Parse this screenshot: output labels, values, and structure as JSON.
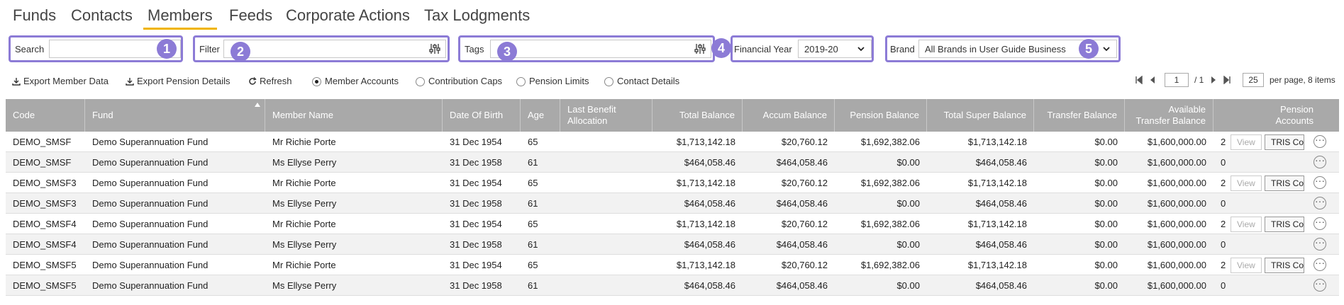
{
  "nav": {
    "tabs": [
      "Funds",
      "Contacts",
      "Members",
      "Feeds",
      "Corporate Actions",
      "Tax Lodgments"
    ],
    "active": "Members"
  },
  "filters": {
    "search": {
      "label": "Search",
      "value": "",
      "badge": "1"
    },
    "filter": {
      "label": "Filter",
      "value": "",
      "badge": "2"
    },
    "tags": {
      "label": "Tags",
      "value": "",
      "badge": "3"
    },
    "financial_year": {
      "label": "Financial Year",
      "value": "2019-20",
      "badge": "4"
    },
    "brand": {
      "label": "Brand",
      "value": "All Brands in User Guide Business",
      "badge": "5"
    }
  },
  "toolbar": {
    "export_member": "Export Member Data",
    "export_pension": "Export Pension Details",
    "refresh": "Refresh",
    "views": [
      {
        "label": "Member Accounts",
        "selected": true
      },
      {
        "label": "Contribution Caps",
        "selected": false
      },
      {
        "label": "Pension Limits",
        "selected": false
      },
      {
        "label": "Contact Details",
        "selected": false
      }
    ]
  },
  "pager": {
    "page": "1",
    "of": "/ 1",
    "per_page": "25",
    "summary": "per page, 8 items"
  },
  "table": {
    "headers": {
      "code": "Code",
      "fund": "Fund",
      "member": "Member Name",
      "dob": "Date Of Birth",
      "age": "Age",
      "lba": "Last Benefit Allocation",
      "total": "Total Balance",
      "accum": "Accum Balance",
      "pension": "Pension Balance",
      "super": "Total Super Balance",
      "transfer": "Transfer Balance",
      "avail": "Available Transfer Balance",
      "accounts": "Pension Accounts"
    },
    "sorted_column": "fund",
    "rows": [
      {
        "code": "DEMO_SMSF",
        "fund": "Demo Superannuation Fund",
        "member": "Mr Richie Porte",
        "dob": "31 Dec 1954",
        "age": "65",
        "lba": "",
        "total": "$1,713,142.18",
        "accum": "$20,760.12",
        "pension": "$1,692,382.06",
        "super": "$1,713,142.18",
        "transfer": "$0.00",
        "avail": "$1,600,000.00",
        "accounts": "2",
        "view": "View",
        "tris": "TRIS Co"
      },
      {
        "code": "DEMO_SMSF",
        "fund": "Demo Superannuation Fund",
        "member": "Ms Ellyse Perry",
        "dob": "31 Dec 1958",
        "age": "61",
        "lba": "",
        "total": "$464,058.46",
        "accum": "$464,058.46",
        "pension": "$0.00",
        "super": "$464,058.46",
        "transfer": "$0.00",
        "avail": "$1,600,000.00",
        "accounts": "0",
        "view": "",
        "tris": ""
      },
      {
        "code": "DEMO_SMSF3",
        "fund": "Demo Superannuation Fund",
        "member": "Mr Richie Porte",
        "dob": "31 Dec 1954",
        "age": "65",
        "lba": "",
        "total": "$1,713,142.18",
        "accum": "$20,760.12",
        "pension": "$1,692,382.06",
        "super": "$1,713,142.18",
        "transfer": "$0.00",
        "avail": "$1,600,000.00",
        "accounts": "2",
        "view": "View",
        "tris": "TRIS Co"
      },
      {
        "code": "DEMO_SMSF3",
        "fund": "Demo Superannuation Fund",
        "member": "Ms Ellyse Perry",
        "dob": "31 Dec 1958",
        "age": "61",
        "lba": "",
        "total": "$464,058.46",
        "accum": "$464,058.46",
        "pension": "$0.00",
        "super": "$464,058.46",
        "transfer": "$0.00",
        "avail": "$1,600,000.00",
        "accounts": "0",
        "view": "",
        "tris": ""
      },
      {
        "code": "DEMO_SMSF4",
        "fund": "Demo Superannuation Fund",
        "member": "Mr Richie Porte",
        "dob": "31 Dec 1954",
        "age": "65",
        "lba": "",
        "total": "$1,713,142.18",
        "accum": "$20,760.12",
        "pension": "$1,692,382.06",
        "super": "$1,713,142.18",
        "transfer": "$0.00",
        "avail": "$1,600,000.00",
        "accounts": "2",
        "view": "View",
        "tris": "TRIS Co"
      },
      {
        "code": "DEMO_SMSF4",
        "fund": "Demo Superannuation Fund",
        "member": "Ms Ellyse Perry",
        "dob": "31 Dec 1958",
        "age": "61",
        "lba": "",
        "total": "$464,058.46",
        "accum": "$464,058.46",
        "pension": "$0.00",
        "super": "$464,058.46",
        "transfer": "$0.00",
        "avail": "$1,600,000.00",
        "accounts": "0",
        "view": "",
        "tris": ""
      },
      {
        "code": "DEMO_SMSF5",
        "fund": "Demo Superannuation Fund",
        "member": "Mr Richie Porte",
        "dob": "31 Dec 1954",
        "age": "65",
        "lba": "",
        "total": "$1,713,142.18",
        "accum": "$20,760.12",
        "pension": "$1,692,382.06",
        "super": "$1,713,142.18",
        "transfer": "$0.00",
        "avail": "$1,600,000.00",
        "accounts": "2",
        "view": "View",
        "tris": "TRIS Co"
      },
      {
        "code": "DEMO_SMSF5",
        "fund": "Demo Superannuation Fund",
        "member": "Ms Ellyse Perry",
        "dob": "31 Dec 1958",
        "age": "61",
        "lba": "",
        "total": "$464,058.46",
        "accum": "$464,058.46",
        "pension": "$0.00",
        "super": "$464,058.46",
        "transfer": "$0.00",
        "avail": "$1,600,000.00",
        "accounts": "0",
        "view": "",
        "tris": ""
      }
    ]
  },
  "colors": {
    "accent": "#8c7bd6",
    "active_tab": "#f0b400",
    "header_bg": "#a9a9a9"
  }
}
